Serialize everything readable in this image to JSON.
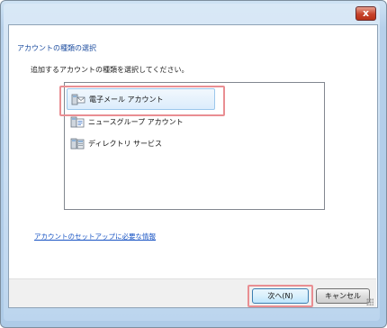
{
  "window": {
    "close_label": "x"
  },
  "wizard": {
    "section_title": "アカウントの種類の選択",
    "instruction": "追加するアカウントの種類を選択してください。",
    "account_types": [
      {
        "label": "電子メール アカウント",
        "icon": "email-account-icon",
        "selected": true
      },
      {
        "label": "ニュースグループ アカウント",
        "icon": "newsgroup-account-icon",
        "selected": false
      },
      {
        "label": "ディレクトリ サービス",
        "icon": "directory-service-icon",
        "selected": false
      }
    ],
    "help_link": "アカウントのセットアップに必要な情報"
  },
  "footer": {
    "next_label": "次へ(N)",
    "cancel_label": "キャンセル"
  },
  "colors": {
    "title_blue": "#1e4ea0",
    "link_blue": "#1a55c4",
    "highlight": "#e98e92"
  }
}
